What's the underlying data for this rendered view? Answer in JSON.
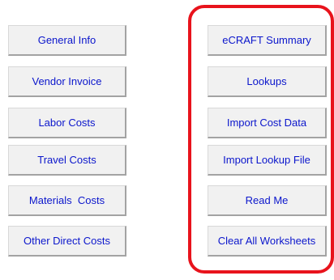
{
  "left_buttons": [
    {
      "label": "General Info"
    },
    {
      "label": "Vendor Invoice"
    },
    {
      "label": "Labor Costs"
    },
    {
      "label": "Travel Costs"
    },
    {
      "label": "Materials  Costs"
    },
    {
      "label": "Other Direct Costs"
    }
  ],
  "right_buttons": [
    {
      "label": "eCRAFT Summary"
    },
    {
      "label": "Lookups"
    },
    {
      "label": "Import Cost Data"
    },
    {
      "label": "Import Lookup File"
    },
    {
      "label": "Read Me"
    },
    {
      "label": "Clear All Worksheets"
    }
  ],
  "colors": {
    "button_text": "#0b16cc",
    "button_face": "#f1f1f1",
    "highlight_outline": "#e8131c"
  }
}
